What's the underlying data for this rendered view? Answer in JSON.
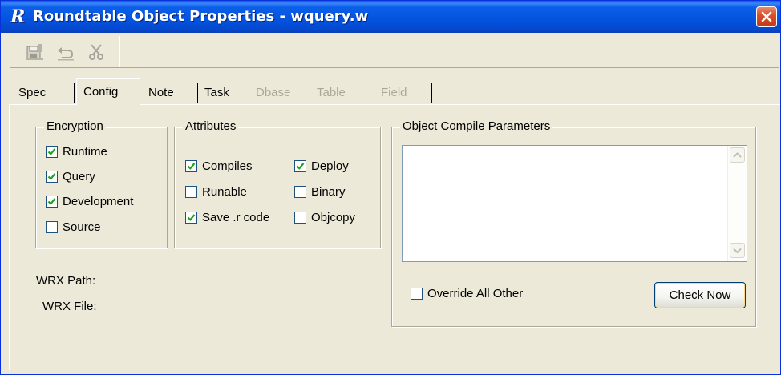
{
  "window": {
    "title": "Roundtable Object Properties - wquery.w",
    "app_icon_letter": "R",
    "close_icon": "close-x-icon"
  },
  "toolbar": {
    "buttons": [
      {
        "name": "save-icon",
        "enabled": false
      },
      {
        "name": "undo-icon",
        "enabled": false
      },
      {
        "name": "cut-icon",
        "enabled": false
      }
    ]
  },
  "tabs": [
    {
      "label": "Spec",
      "state": "normal"
    },
    {
      "label": "Config",
      "state": "active"
    },
    {
      "label": "Note",
      "state": "normal"
    },
    {
      "label": "Task",
      "state": "normal"
    },
    {
      "label": "Dbase",
      "state": "disabled"
    },
    {
      "label": "Table",
      "state": "disabled"
    },
    {
      "label": "Field",
      "state": "disabled"
    }
  ],
  "encryption": {
    "title": "Encryption",
    "options": [
      {
        "label": "Runtime",
        "checked": true
      },
      {
        "label": "Query",
        "checked": true
      },
      {
        "label": "Development",
        "checked": true
      },
      {
        "label": "Source",
        "checked": false
      }
    ]
  },
  "attributes": {
    "title": "Attributes",
    "options": [
      {
        "label": "Compiles",
        "checked": true
      },
      {
        "label": "Deploy",
        "checked": true
      },
      {
        "label": "Runable",
        "checked": false
      },
      {
        "label": "Binary",
        "checked": false
      },
      {
        "label": "Save .r code",
        "checked": true
      },
      {
        "label": "Objcopy",
        "checked": false
      }
    ]
  },
  "wrx": {
    "path_label": "WRX Path:",
    "file_label": "WRX File:"
  },
  "compile": {
    "title": "Object Compile Parameters",
    "params_value": "",
    "override_label": "Override All Other",
    "override_checked": false,
    "check_now_label": "Check Now"
  },
  "colors": {
    "titlebar": "#0453de",
    "face": "#ece9d8",
    "check": "#21a121"
  }
}
